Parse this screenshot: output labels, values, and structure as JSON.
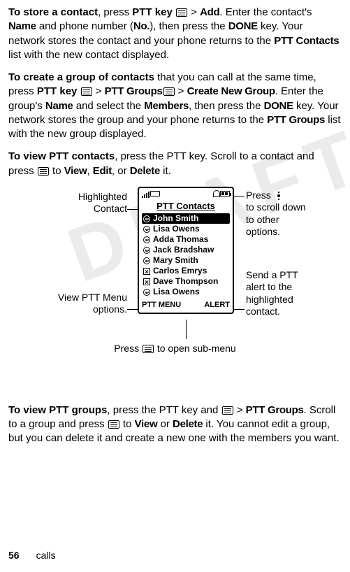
{
  "watermark": "DRAFT",
  "p1": {
    "lead": "To store a contact",
    "t1": ", press ",
    "pttkey": "PTT key",
    "gt": " > ",
    "add": "Add",
    "t2": ". Enter the contact's ",
    "name": "Name",
    "t3": " and phone number (",
    "no": "No.",
    "t4": "), then press the ",
    "done": "DONE",
    "t5": " key. Your network stores the contact and your phone returns to the ",
    "pttcontacts": "PTT Contacts",
    "t6": " list with the new contact displayed."
  },
  "p2": {
    "lead": "To create a group of contacts",
    "t1": " that you can call at the same time, press ",
    "pttkey": "PTT key",
    "gt": " > ",
    "pttgroups": "PTT Groups",
    "gt2": " > ",
    "cng": "Create New Group",
    "t2": ". Enter the group's ",
    "name": "Name",
    "t3": " and select the ",
    "members": "Members",
    "t4": ", then press the ",
    "done": "DONE",
    "t5": " key. Your network stores the group and your phone returns to the ",
    "pttgroups2": "PTT Groups",
    "t6": " list with the new group displayed."
  },
  "p3": {
    "lead": "To view PTT contacts",
    "t1": ", press the PTT key. Scroll to a contact and press ",
    "to": " to ",
    "view": "View",
    "c1": ", ",
    "edit": "Edit",
    "c2": ", or ",
    "delete": "Delete",
    "t2": " it."
  },
  "phone": {
    "title": "PTT Contacts",
    "contacts": [
      {
        "name": "John Smith",
        "status": "online",
        "highlight": true
      },
      {
        "name": "Lisa Owens",
        "status": "online"
      },
      {
        "name": "Adda Thomas",
        "status": "online"
      },
      {
        "name": "Jack Bradshaw",
        "status": "online"
      },
      {
        "name": "Mary Smith",
        "status": "online"
      },
      {
        "name": "Carlos Emrys",
        "status": "offline"
      },
      {
        "name": "Dave Thompson",
        "status": "offline"
      },
      {
        "name": "Lisa Owens",
        "status": "online"
      }
    ],
    "leftSoft": "PTT MENU",
    "rightSoft": "ALERT"
  },
  "callouts": {
    "hc1": "Highlighted",
    "hc2": "Contact",
    "vm1": "View PTT Menu",
    "vm2": "options.",
    "scroll1": "Press ",
    "scroll2": "to scroll down",
    "scroll3": "to other",
    "scroll4": "options.",
    "alert1": "Send a PTT",
    "alert2": "alert to the",
    "alert3": "highlighted",
    "alert4": "contact.",
    "sub1": "Press ",
    "sub2": " to open sub-menu"
  },
  "p4": {
    "lead": "To view PTT groups",
    "t1": ", press the PTT key and ",
    "gt": " > ",
    "pttgroups": "PTT Groups",
    "t2": ". Scroll to a group and press ",
    "to": " to ",
    "view": "View",
    "or": " or ",
    "delete": "Delete",
    "t3": " it. You cannot edit a group, but you can delete it and create a new one with the members you want."
  },
  "footer": {
    "page": "56",
    "section": "calls"
  }
}
